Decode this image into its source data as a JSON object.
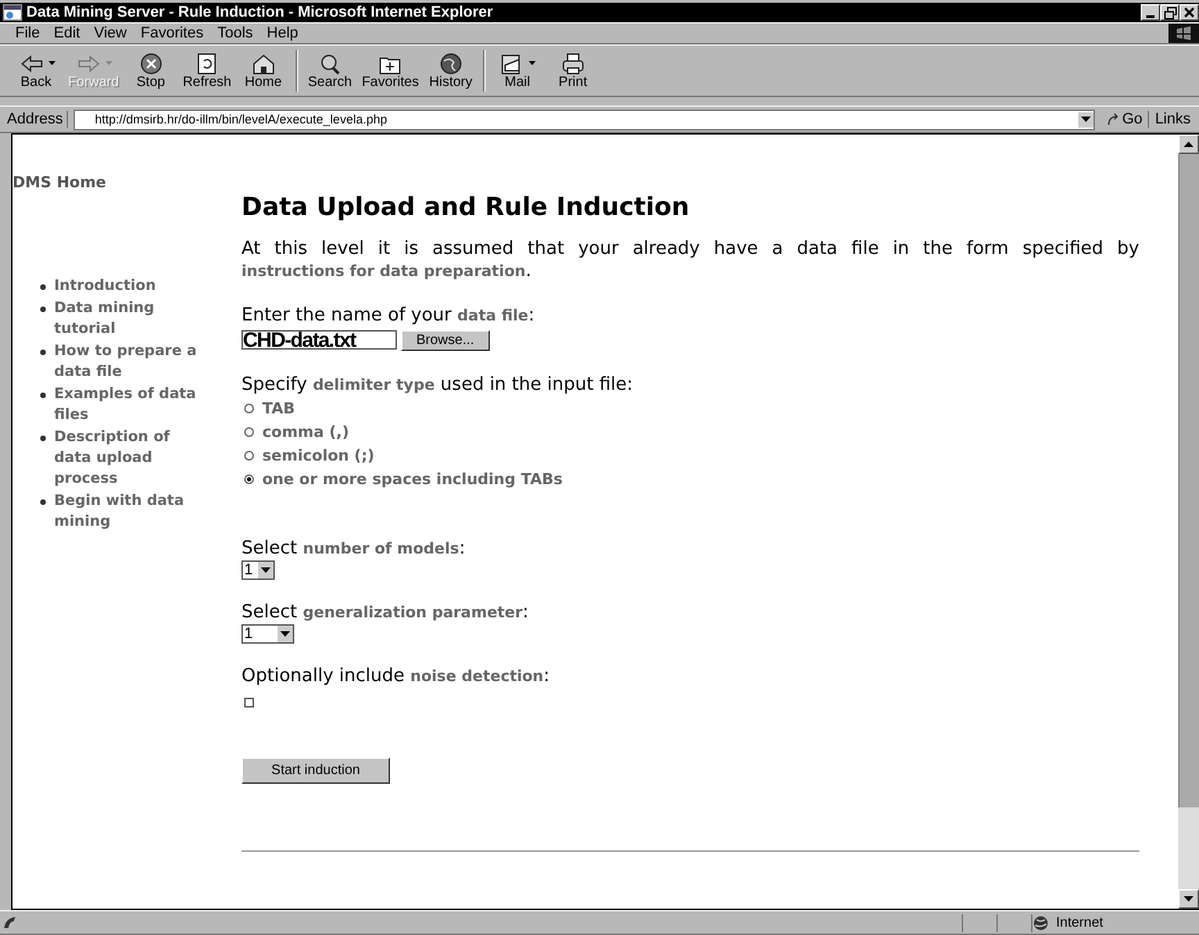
{
  "window": {
    "title": "Data Mining Server - Rule Induction - Microsoft Internet Explorer"
  },
  "menu": [
    "File",
    "Edit",
    "View",
    "Favorites",
    "Tools",
    "Help"
  ],
  "toolbar": [
    {
      "label": "Back",
      "kind": "back",
      "disabled": false,
      "dropdown": true
    },
    {
      "label": "Forward",
      "kind": "forward",
      "disabled": true,
      "dropdown": true
    },
    {
      "label": "Stop",
      "kind": "stop",
      "disabled": false,
      "dropdown": false
    },
    {
      "label": "Refresh",
      "kind": "refresh",
      "disabled": false,
      "dropdown": false
    },
    {
      "label": "Home",
      "kind": "home",
      "disabled": false,
      "dropdown": false
    },
    {
      "label": "Search",
      "kind": "search",
      "disabled": false,
      "dropdown": false
    },
    {
      "label": "Favorites",
      "kind": "favorites",
      "disabled": false,
      "dropdown": false
    },
    {
      "label": "History",
      "kind": "history",
      "disabled": false,
      "dropdown": false
    },
    {
      "label": "Mail",
      "kind": "mail",
      "disabled": false,
      "dropdown": true
    },
    {
      "label": "Print",
      "kind": "print",
      "disabled": false,
      "dropdown": false
    }
  ],
  "address": {
    "label": "Address",
    "value": "http://dmsirb.hr/do-illm/bin/levelA/execute_levela.php",
    "go": "Go",
    "links": "Links"
  },
  "sidebar": {
    "home": "DMS Home",
    "items": [
      "Introduction",
      "Data mining tutorial",
      "How to prepare a data file",
      "Examples of data files",
      "Description of data upload process",
      "Begin with data mining"
    ]
  },
  "page": {
    "heading": "Data Upload and Rule Induction",
    "intro": {
      "before": "At this level it is assumed that your already have a data file in the form specified by",
      "link": "instructions for data preparation",
      "after": "."
    },
    "file": {
      "before": "Enter the name of your",
      "link": "data file",
      "after": ":",
      "value": "CHD-data.txt",
      "button": "Browse..."
    },
    "delimiter": {
      "before": "Specify",
      "link": "delimiter type",
      "after": "used in the input file:",
      "options": [
        {
          "label": "TAB",
          "selected": false
        },
        {
          "label": "comma (,)",
          "selected": false
        },
        {
          "label": "semicolon (;)",
          "selected": false
        },
        {
          "label": "one or more spaces including TABs",
          "selected": true
        }
      ]
    },
    "models": {
      "before": "Select",
      "link": "number of models",
      "after": ":",
      "value": "1"
    },
    "generalization": {
      "before": "Select",
      "link": "generalization parameter",
      "after": ":",
      "value": "1"
    },
    "noise": {
      "before": "Optionally include",
      "link": "noise detection",
      "after": ":",
      "checked": false
    },
    "submit": "Start induction"
  },
  "status_bar": {
    "zone": "Internet"
  }
}
